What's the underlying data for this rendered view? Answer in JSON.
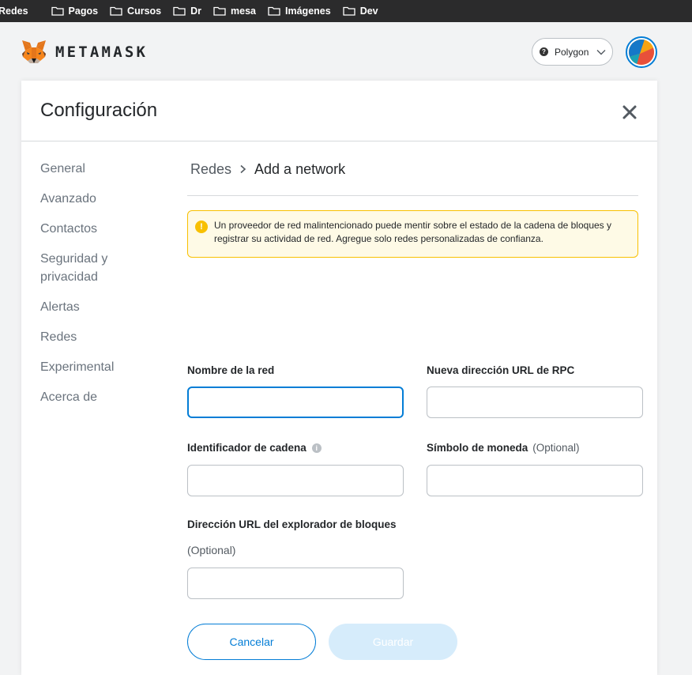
{
  "bookmarks": [
    "Redes",
    "Pagos",
    "Cursos",
    "Dr",
    "mesa",
    "Imágenes",
    "Dev"
  ],
  "header": {
    "logo_text": "METAMASK",
    "network": "Polygon",
    "network_icon_glyph": "?"
  },
  "settings": {
    "title": "Configuración",
    "sidebar": [
      "General",
      "Avanzado",
      "Contactos",
      "Seguridad y privacidad",
      "Alertas",
      "Redes",
      "Experimental",
      "Acerca de"
    ],
    "breadcrumb": {
      "parent": "Redes",
      "current": "Add a network"
    },
    "warning": {
      "icon_glyph": "!",
      "text": "Un proveedor de red malintencionado puede mentir sobre el estado de la cadena de bloques y registrar su actividad de red. Agregue solo redes personalizadas de confianza."
    },
    "form": {
      "network_name_label": "Nombre de la red",
      "network_name_value": "",
      "rpc_url_label": "Nueva dirección URL de RPC",
      "rpc_url_value": "",
      "chain_id_label": "Identificador de cadena",
      "chain_id_info_glyph": "i",
      "chain_id_value": "",
      "currency_symbol_label": "Símbolo de moneda",
      "currency_symbol_optional": "(Optional)",
      "currency_symbol_value": "",
      "explorer_label": "Dirección URL del explorador de bloques",
      "explorer_optional": "(Optional)",
      "explorer_value": ""
    },
    "buttons": {
      "cancel": "Cancelar",
      "save": "Guardar"
    }
  },
  "colors": {
    "accent": "#037dd6",
    "warning_border": "#f8c000",
    "warning_bg": "#fefae6",
    "save_disabled": "#d6ecfb"
  }
}
